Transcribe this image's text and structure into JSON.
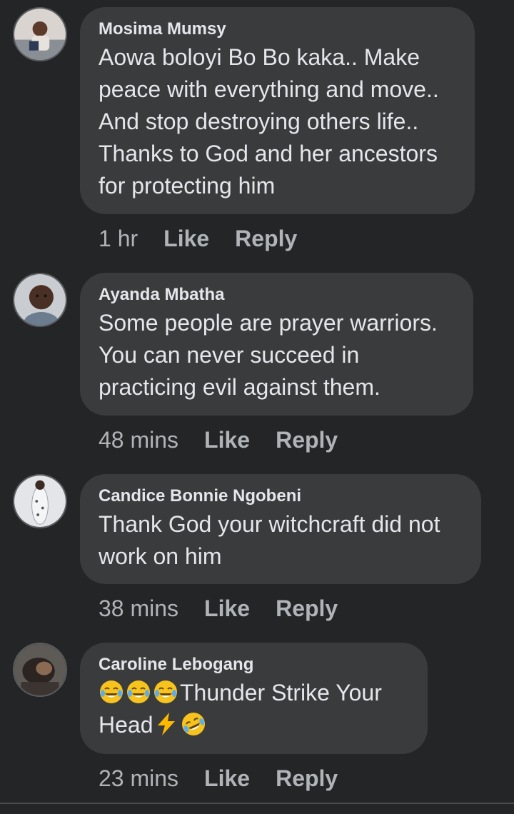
{
  "comments": [
    {
      "author": "Mosima Mumsy",
      "lines": [
        "Aowa boloyi Bo Bo kaka.. Make",
        "peace with everything and move..",
        "And stop destroying others life..",
        "Thanks to God and her ancestors",
        "for protecting him"
      ],
      "time": "1 hr",
      "like": "Like",
      "reply": "Reply"
    },
    {
      "author": "Ayanda Mbatha",
      "lines": [
        "Some people are prayer warriors.",
        "You can never succeed in",
        "practicing evil against them."
      ],
      "time": "48 mins",
      "like": "Like",
      "reply": "Reply"
    },
    {
      "author": "Candice Bonnie Ngobeni",
      "lines": [
        "Thank God your witchcraft did not",
        "work on him"
      ],
      "time": "38 mins",
      "like": "Like",
      "reply": "Reply"
    },
    {
      "author": "Caroline Lebogang",
      "line1_text": "Thunder Strike Your",
      "line2_text": "Head",
      "emoji_names": [
        "face-with-tears-of-joy-icon",
        "lightning-icon",
        "rolling-on-floor-laughing-icon"
      ],
      "time": "23 mins",
      "like": "Like",
      "reply": "Reply"
    }
  ]
}
